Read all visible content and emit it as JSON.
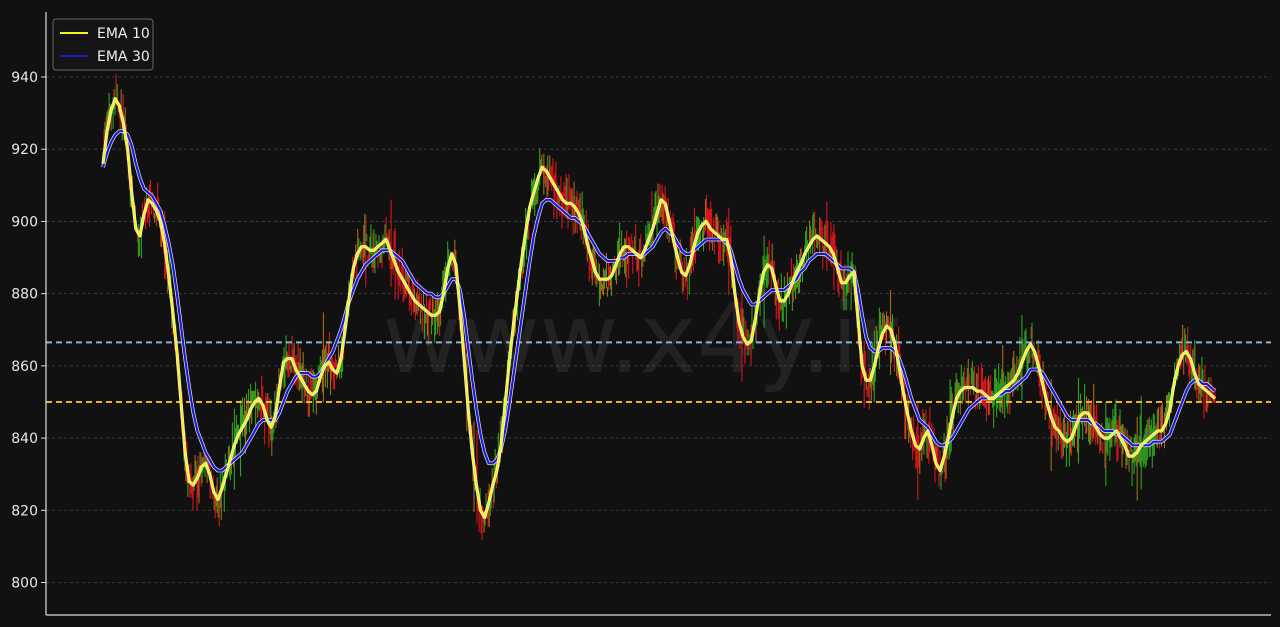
{
  "chart_data": {
    "type": "line",
    "title": "",
    "xlabel": "",
    "ylabel": "",
    "ylim": [
      791,
      958
    ],
    "yticks": [
      800,
      820,
      840,
      860,
      880,
      900,
      920,
      940
    ],
    "grid": true,
    "legend_position": "top-left",
    "watermark": "www.x4y.ir",
    "price_colors": {
      "up": "#2fa11e",
      "down": "#d8141a",
      "mixed": "#a66a1a"
    },
    "reference_lines": [
      {
        "value": 866.5,
        "color": "#8ab4d4",
        "style": "dashed"
      },
      {
        "value": 850,
        "color": "#e8b32a",
        "style": "dashed"
      }
    ],
    "series": [
      {
        "name": "EMA 10",
        "color": "#f5f51a",
        "values": [
          916,
          925,
          931,
          934,
          932,
          927,
          920,
          908,
          898,
          896,
          902,
          906,
          905,
          903,
          900,
          894,
          885,
          875,
          864,
          850,
          836,
          828,
          827,
          829,
          832,
          833,
          830,
          825,
          823,
          826,
          830,
          834,
          838,
          841,
          843,
          845,
          848,
          850,
          851,
          849,
          845,
          843,
          846,
          854,
          861,
          862,
          862,
          859,
          857,
          855,
          853,
          852,
          853,
          857,
          860,
          861,
          859,
          858,
          862,
          870,
          879,
          887,
          891,
          893,
          893,
          892,
          892,
          893,
          894,
          895,
          892,
          889,
          886,
          884,
          882,
          880,
          878,
          877,
          876,
          875,
          874,
          874,
          875,
          880,
          887,
          891,
          888,
          876,
          862,
          848,
          836,
          827,
          820,
          818,
          822,
          827,
          831,
          838,
          849,
          861,
          871,
          880,
          889,
          897,
          904,
          908,
          912,
          915,
          914,
          912,
          910,
          908,
          906,
          905,
          905,
          904,
          902,
          899,
          894,
          890,
          886,
          884,
          884,
          884,
          885,
          888,
          891,
          893,
          893,
          892,
          891,
          890,
          892,
          895,
          898,
          902,
          906,
          905,
          900,
          895,
          890,
          886,
          885,
          888,
          893,
          897,
          899,
          900,
          898,
          897,
          896,
          895,
          895,
          890,
          880,
          872,
          868,
          866,
          867,
          873,
          880,
          886,
          888,
          887,
          882,
          878,
          878,
          880,
          883,
          886,
          888,
          891,
          893,
          895,
          896,
          895,
          894,
          893,
          891,
          887,
          883,
          883,
          885,
          886,
          873,
          860,
          856,
          856,
          860,
          865,
          869,
          871,
          870,
          866,
          860,
          853,
          847,
          842,
          838,
          837,
          840,
          842,
          838,
          833,
          831,
          835,
          840,
          846,
          851,
          853,
          854,
          854,
          854,
          853,
          853,
          852,
          851,
          851,
          852,
          853,
          854,
          855,
          856,
          858,
          861,
          864,
          866,
          864,
          860,
          855,
          850,
          846,
          843,
          842,
          840,
          839,
          840,
          843,
          846,
          847,
          847,
          845,
          843,
          841,
          840,
          840,
          841,
          842,
          840,
          838,
          835,
          835,
          836,
          838,
          839,
          840,
          841,
          842,
          842,
          844,
          848,
          855,
          860,
          863,
          864,
          862,
          858,
          855,
          854,
          853,
          852,
          851
        ]
      },
      {
        "name": "EMA 30",
        "color": "#1a1ad0",
        "values": [
          915,
          919,
          922,
          924,
          925,
          925,
          924,
          921,
          916,
          912,
          909,
          908,
          907,
          905,
          903,
          899,
          894,
          888,
          880,
          871,
          862,
          854,
          847,
          842,
          839,
          836,
          834,
          832,
          831,
          831,
          832,
          833,
          834,
          835,
          836,
          838,
          840,
          842,
          844,
          845,
          845,
          845,
          845,
          847,
          850,
          853,
          855,
          857,
          858,
          858,
          858,
          857,
          857,
          858,
          860,
          862,
          864,
          867,
          870,
          874,
          878,
          881,
          884,
          886,
          888,
          889,
          890,
          891,
          892,
          892,
          892,
          891,
          890,
          889,
          887,
          885,
          883,
          882,
          881,
          880,
          880,
          879,
          879,
          880,
          882,
          884,
          884,
          881,
          874,
          865,
          856,
          848,
          841,
          836,
          833,
          833,
          834,
          837,
          842,
          849,
          857,
          865,
          873,
          881,
          889,
          896,
          901,
          905,
          906,
          906,
          905,
          904,
          903,
          902,
          901,
          901,
          900,
          899,
          897,
          895,
          893,
          891,
          890,
          889,
          889,
          889,
          890,
          890,
          891,
          891,
          891,
          890,
          891,
          892,
          893,
          895,
          897,
          898,
          897,
          896,
          894,
          892,
          891,
          891,
          892,
          893,
          894,
          895,
          895,
          895,
          895,
          895,
          894,
          892,
          888,
          884,
          881,
          879,
          877,
          877,
          878,
          879,
          880,
          881,
          881,
          881,
          881,
          882,
          883,
          884,
          886,
          887,
          889,
          890,
          891,
          891,
          891,
          890,
          889,
          888,
          887,
          887,
          887,
          886,
          881,
          874,
          868,
          865,
          864,
          864,
          865,
          865,
          865,
          864,
          862,
          859,
          855,
          851,
          848,
          845,
          844,
          843,
          841,
          839,
          838,
          838,
          839,
          840,
          842,
          844,
          846,
          848,
          849,
          850,
          851,
          851,
          851,
          851,
          852,
          852,
          853,
          853,
          854,
          855,
          856,
          857,
          859,
          859,
          859,
          858,
          856,
          854,
          852,
          850,
          848,
          846,
          845,
          845,
          845,
          845,
          845,
          844,
          844,
          843,
          842,
          842,
          842,
          841,
          841,
          840,
          839,
          838,
          838,
          838,
          838,
          838,
          839,
          839,
          839,
          840,
          841,
          844,
          847,
          850,
          853,
          855,
          856,
          856,
          855,
          855,
          854,
          853
        ]
      }
    ]
  }
}
